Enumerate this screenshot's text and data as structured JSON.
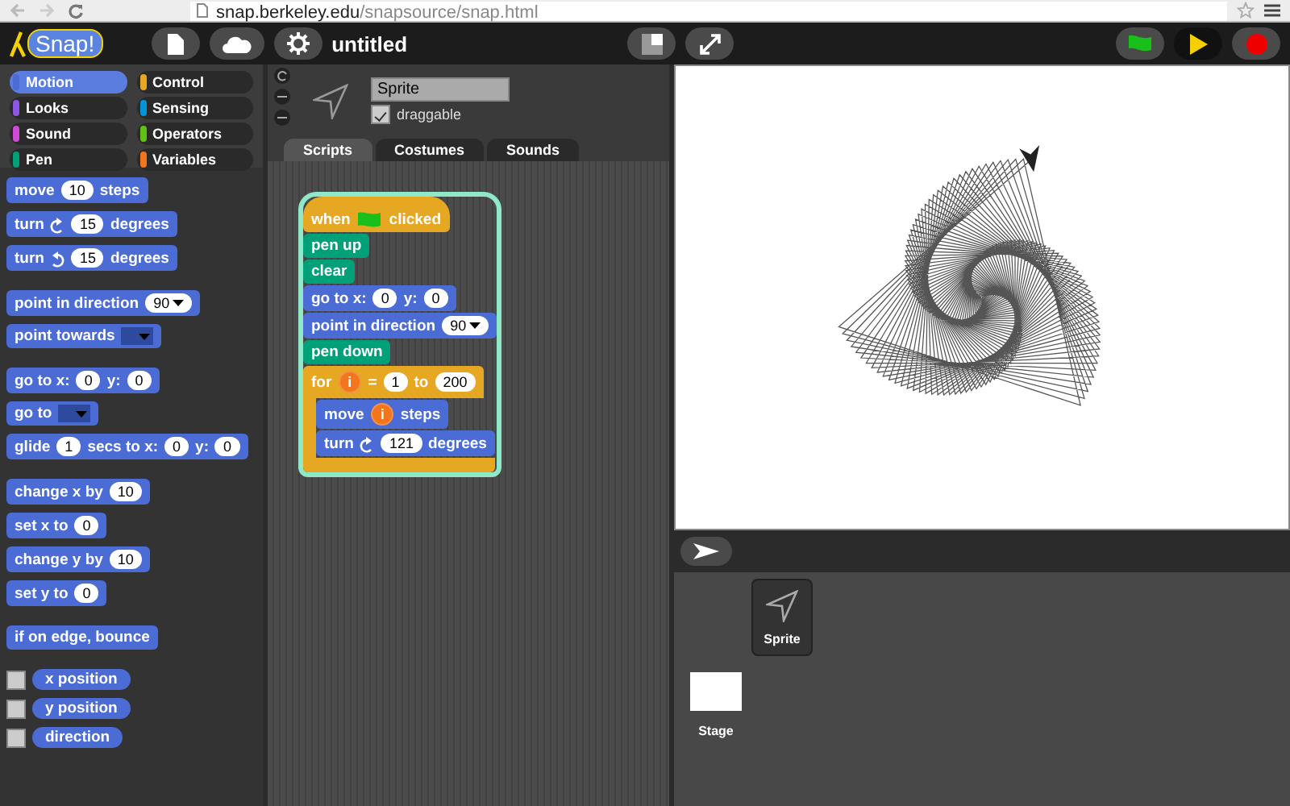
{
  "browser": {
    "url_host": "snap.berkeley.edu",
    "url_path": "/snapsource/snap.html"
  },
  "toolbar": {
    "logo_text": "Snap!",
    "project_title": "untitled"
  },
  "categories": [
    {
      "label": "Motion",
      "color": "#4a6cd4",
      "selected": true
    },
    {
      "label": "Control",
      "color": "#e6a822",
      "selected": false
    },
    {
      "label": "Looks",
      "color": "#8f56e3",
      "selected": false
    },
    {
      "label": "Sensing",
      "color": "#0494dc",
      "selected": false
    },
    {
      "label": "Sound",
      "color": "#cf4ad9",
      "selected": false
    },
    {
      "label": "Operators",
      "color": "#62c213",
      "selected": false
    },
    {
      "label": "Pen",
      "color": "#00a178",
      "selected": false
    },
    {
      "label": "Variables",
      "color": "#f3761d",
      "selected": false
    }
  ],
  "palette": {
    "groups": [
      [
        {
          "kind": "command",
          "color": "#4a6cd4",
          "parts": [
            {
              "kind": "text",
              "text": "move"
            },
            {
              "kind": "num",
              "text": "10"
            },
            {
              "kind": "text",
              "text": "steps"
            }
          ]
        },
        {
          "kind": "command",
          "color": "#4a6cd4",
          "parts": [
            {
              "kind": "text",
              "text": "turn"
            },
            {
              "kind": "cw"
            },
            {
              "kind": "num",
              "text": "15"
            },
            {
              "kind": "text",
              "text": "degrees"
            }
          ]
        },
        {
          "kind": "command",
          "color": "#4a6cd4",
          "parts": [
            {
              "kind": "text",
              "text": "turn"
            },
            {
              "kind": "ccw"
            },
            {
              "kind": "num",
              "text": "15"
            },
            {
              "kind": "text",
              "text": "degrees"
            }
          ]
        }
      ],
      [
        {
          "kind": "command",
          "color": "#4a6cd4",
          "parts": [
            {
              "kind": "text",
              "text": "point in direction"
            },
            {
              "kind": "dropdown",
              "text": "90"
            }
          ]
        },
        {
          "kind": "command",
          "color": "#4a6cd4",
          "parts": [
            {
              "kind": "text",
              "text": "point towards"
            },
            {
              "kind": "menu"
            }
          ]
        }
      ],
      [
        {
          "kind": "command",
          "color": "#4a6cd4",
          "parts": [
            {
              "kind": "text",
              "text": "go to x:"
            },
            {
              "kind": "num",
              "text": "0"
            },
            {
              "kind": "text",
              "text": "y:"
            },
            {
              "kind": "num",
              "text": "0"
            }
          ]
        },
        {
          "kind": "command",
          "color": "#4a6cd4",
          "parts": [
            {
              "kind": "text",
              "text": "go to"
            },
            {
              "kind": "menu"
            }
          ]
        },
        {
          "kind": "command",
          "color": "#4a6cd4",
          "parts": [
            {
              "kind": "text",
              "text": "glide"
            },
            {
              "kind": "num",
              "text": "1"
            },
            {
              "kind": "text",
              "text": "secs to x:"
            },
            {
              "kind": "num",
              "text": "0"
            },
            {
              "kind": "text",
              "text": "y:"
            },
            {
              "kind": "num",
              "text": "0"
            }
          ]
        }
      ],
      [
        {
          "kind": "command",
          "color": "#4a6cd4",
          "parts": [
            {
              "kind": "text",
              "text": "change x by"
            },
            {
              "kind": "num",
              "text": "10"
            }
          ]
        },
        {
          "kind": "command",
          "color": "#4a6cd4",
          "parts": [
            {
              "kind": "text",
              "text": "set x to"
            },
            {
              "kind": "num",
              "text": "0"
            }
          ]
        },
        {
          "kind": "command",
          "color": "#4a6cd4",
          "parts": [
            {
              "kind": "text",
              "text": "change y by"
            },
            {
              "kind": "num",
              "text": "10"
            }
          ]
        },
        {
          "kind": "command",
          "color": "#4a6cd4",
          "parts": [
            {
              "kind": "text",
              "text": "set y to"
            },
            {
              "kind": "num",
              "text": "0"
            }
          ]
        }
      ],
      [
        {
          "kind": "command",
          "color": "#4a6cd4",
          "parts": [
            {
              "kind": "text",
              "text": "if on edge, bounce"
            }
          ]
        }
      ],
      [
        {
          "kind": "reporter",
          "color": "#4a6cd4",
          "checked": false,
          "parts": [
            {
              "kind": "text",
              "text": "x position"
            }
          ]
        },
        {
          "kind": "reporter",
          "color": "#4a6cd4",
          "checked": false,
          "parts": [
            {
              "kind": "text",
              "text": "y position"
            }
          ]
        },
        {
          "kind": "reporter",
          "color": "#4a6cd4",
          "checked": false,
          "parts": [
            {
              "kind": "text",
              "text": "direction"
            }
          ]
        }
      ]
    ]
  },
  "sprite": {
    "name": "Sprite",
    "draggable": true,
    "draggable_label": "draggable",
    "tabs": [
      {
        "label": "Scripts",
        "selected": true
      },
      {
        "label": "Costumes",
        "selected": false
      },
      {
        "label": "Sounds",
        "selected": false
      }
    ]
  },
  "script": {
    "running": true,
    "blocks": [
      {
        "kind": "hat",
        "color": "#e6a822",
        "parts": [
          {
            "kind": "text",
            "text": "when"
          },
          {
            "kind": "flag"
          },
          {
            "kind": "text",
            "text": "clicked"
          }
        ]
      },
      {
        "kind": "command",
        "color": "#00a178",
        "parts": [
          {
            "kind": "text",
            "text": "pen up"
          }
        ]
      },
      {
        "kind": "command",
        "color": "#00a178",
        "parts": [
          {
            "kind": "text",
            "text": "clear"
          }
        ]
      },
      {
        "kind": "command",
        "color": "#4a6cd4",
        "parts": [
          {
            "kind": "text",
            "text": "go to x:"
          },
          {
            "kind": "num",
            "text": "0"
          },
          {
            "kind": "text",
            "text": "y:"
          },
          {
            "kind": "num",
            "text": "0"
          }
        ]
      },
      {
        "kind": "command",
        "color": "#4a6cd4",
        "parts": [
          {
            "kind": "text",
            "text": "point in direction"
          },
          {
            "kind": "dropdown",
            "text": "90"
          }
        ]
      },
      {
        "kind": "command",
        "color": "#00a178",
        "parts": [
          {
            "kind": "text",
            "text": "pen down"
          }
        ]
      },
      {
        "kind": "loop",
        "color": "#e6a822",
        "parts": [
          {
            "kind": "text",
            "text": "for"
          },
          {
            "kind": "var",
            "text": "i"
          },
          {
            "kind": "text",
            "text": "="
          },
          {
            "kind": "num",
            "text": "1"
          },
          {
            "kind": "text",
            "text": "to"
          },
          {
            "kind": "num",
            "text": "200"
          }
        ],
        "children": [
          {
            "kind": "command",
            "color": "#4a6cd4",
            "parts": [
              {
                "kind": "text",
                "text": "move"
              },
              {
                "kind": "var",
                "text": "i"
              },
              {
                "kind": "text",
                "text": "steps"
              }
            ]
          },
          {
            "kind": "command",
            "color": "#4a6cd4",
            "parts": [
              {
                "kind": "text",
                "text": "turn"
              },
              {
                "kind": "cw"
              },
              {
                "kind": "num",
                "text": "121"
              },
              {
                "kind": "text",
                "text": "degrees"
              }
            ]
          }
        ]
      }
    ]
  },
  "corral": {
    "sprites": [
      {
        "label": "Sprite",
        "selected": true
      }
    ],
    "stage": {
      "label": "Stage"
    }
  }
}
